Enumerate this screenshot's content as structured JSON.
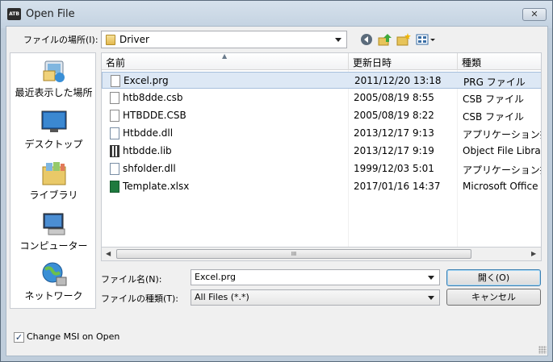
{
  "window": {
    "app_icon_text": "ATB",
    "title": "Open File",
    "close_glyph": "✕"
  },
  "lookin": {
    "label": "ファイルの場所(I):",
    "value": "Driver"
  },
  "toolbar": {
    "back": "back-icon",
    "up": "up-folder-icon",
    "new_folder": "new-folder-icon",
    "view": "view-menu-icon"
  },
  "places": [
    {
      "label": "最近表示した場所",
      "icon": "recent-places-icon"
    },
    {
      "label": "デスクトップ",
      "icon": "desktop-icon"
    },
    {
      "label": "ライブラリ",
      "icon": "library-icon"
    },
    {
      "label": "コンピューター",
      "icon": "computer-icon"
    },
    {
      "label": "ネットワーク",
      "icon": "network-icon"
    }
  ],
  "columns": {
    "name": "名前",
    "modified": "更新日時",
    "type": "種類"
  },
  "files": [
    {
      "name": "Excel.prg",
      "modified": "2011/12/20 13:18",
      "type": "PRG ファイル",
      "selected": true
    },
    {
      "name": "htb8dde.csb",
      "modified": "2005/08/19 8:55",
      "type": "CSB ファイル"
    },
    {
      "name": "HTBDDE.CSB",
      "modified": "2005/08/19 8:22",
      "type": "CSB ファイル"
    },
    {
      "name": "Htbdde.dll",
      "modified": "2013/12/17 9:13",
      "type": "アプリケーション拡張"
    },
    {
      "name": "htbdde.lib",
      "modified": "2013/12/17 9:19",
      "type": "Object File Library"
    },
    {
      "name": "shfolder.dll",
      "modified": "1999/12/03 5:01",
      "type": "アプリケーション拡張"
    },
    {
      "name": "Template.xlsx",
      "modified": "2017/01/16 14:37",
      "type": "Microsoft Office Excel"
    }
  ],
  "scroll": {
    "thumb_grip": "III"
  },
  "filename": {
    "label": "ファイル名(N):",
    "value": "Excel.prg"
  },
  "filetype": {
    "label": "ファイルの種類(T):",
    "value": "All Files (*.*)"
  },
  "buttons": {
    "open": "開く(O)",
    "cancel": "キャンセル"
  },
  "option": {
    "label": "Change MSI on Open",
    "checked": true
  },
  "colors": {
    "title_bg": "#c3d2e1",
    "selection": "#dde8f5",
    "default_border": "#3c7fb1"
  }
}
